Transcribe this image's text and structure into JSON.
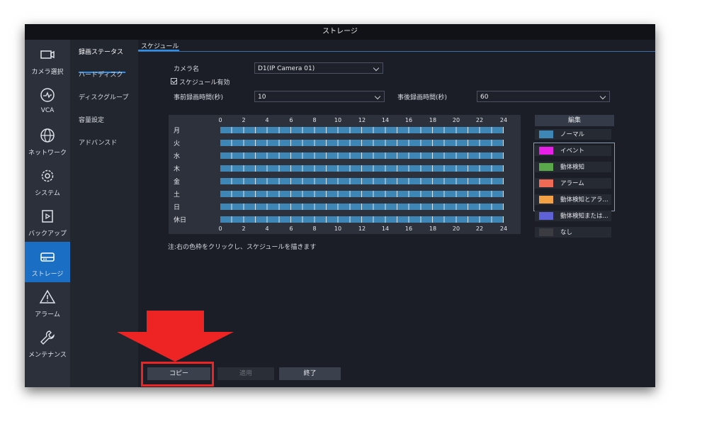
{
  "window": {
    "title": "ストレージ"
  },
  "left_nav": [
    {
      "label": "カメラ選択",
      "icon": "camera-icon"
    },
    {
      "label": "VCA",
      "icon": "vca-icon"
    },
    {
      "label": "ネットワーク",
      "icon": "globe-icon"
    },
    {
      "label": "システム",
      "icon": "gear-icon"
    },
    {
      "label": "バックアップ",
      "icon": "backup-icon"
    },
    {
      "label": "ストレージ",
      "icon": "storage-icon",
      "active": true
    },
    {
      "label": "アラーム",
      "icon": "warning-icon"
    },
    {
      "label": "メンテナンス",
      "icon": "wrench-icon"
    }
  ],
  "sub_nav": [
    "録画ステータス",
    "ハードディスク",
    "ディスクグループ",
    "容量設定",
    "アドバンスド"
  ],
  "tab": "スケジュール",
  "form": {
    "camera_label": "カメラ名",
    "camera_value": "D1(IP Camera 01)",
    "schedule_enabled_label": "スケジュール有効",
    "pre_record_label": "事前録画時間(秒)",
    "pre_record_value": "10",
    "post_record_label": "事後録画時間(秒)",
    "post_record_value": "60"
  },
  "schedule": {
    "hours": [
      "0",
      "2",
      "4",
      "6",
      "8",
      "10",
      "12",
      "14",
      "16",
      "18",
      "20",
      "22",
      "24"
    ],
    "days": [
      "月",
      "火",
      "水",
      "木",
      "金",
      "土",
      "日",
      "休日"
    ]
  },
  "edit_label": "編集",
  "legend": [
    {
      "label": "ノーマル",
      "color": "#3d86b5"
    },
    {
      "label": "イベント",
      "color": "#e81fe6"
    },
    {
      "label": "動体検知",
      "color": "#5aa84a"
    },
    {
      "label": "アラーム",
      "color": "#f06a55"
    },
    {
      "label": "動体検知とアラ...",
      "color": "#f4a044"
    },
    {
      "label": "動体検知または...",
      "color": "#5f61d6"
    },
    {
      "label": "なし",
      "color": "#3a3c42"
    }
  ],
  "note": "注:右の色枠をクリックし、スケジュールを描きます",
  "buttons": {
    "copy": "コピー",
    "apply": "適用",
    "end": "終了"
  },
  "accent": "#1a6fc4",
  "highlight_color": "#ee2424"
}
